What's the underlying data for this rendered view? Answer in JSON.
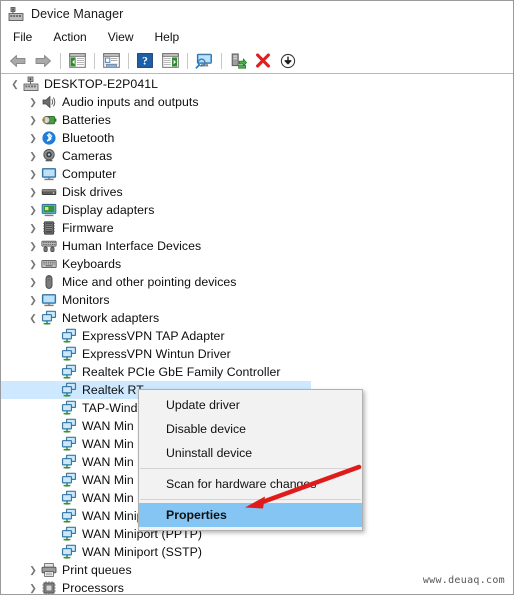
{
  "window": {
    "title": "Device Manager",
    "title_icon": "device-manager-icon"
  },
  "menubar": {
    "items": [
      {
        "label": "File",
        "name": "menu-file"
      },
      {
        "label": "Action",
        "name": "menu-action"
      },
      {
        "label": "View",
        "name": "menu-view"
      },
      {
        "label": "Help",
        "name": "menu-help"
      }
    ]
  },
  "toolbar": {
    "buttons": [
      {
        "icon": "back-arrow-icon",
        "name": "toolbar-back"
      },
      {
        "icon": "forward-arrow-icon",
        "name": "toolbar-forward"
      },
      {
        "sep": true
      },
      {
        "icon": "show-hide-console-tree-icon",
        "name": "toolbar-console-tree"
      },
      {
        "sep": true
      },
      {
        "icon": "properties-icon",
        "name": "toolbar-properties"
      },
      {
        "sep": true
      },
      {
        "icon": "help-icon",
        "name": "toolbar-help"
      },
      {
        "icon": "show-hide-action-pane-icon",
        "name": "toolbar-action-pane"
      },
      {
        "sep": true
      },
      {
        "icon": "scan-hardware-changes-icon",
        "name": "toolbar-scan-hardware"
      },
      {
        "sep": true
      },
      {
        "icon": "update-driver-icon",
        "name": "toolbar-update-driver"
      },
      {
        "icon": "uninstall-device-icon",
        "name": "toolbar-uninstall-device"
      },
      {
        "icon": "disable-device-icon",
        "name": "toolbar-disable-device"
      }
    ]
  },
  "tree": {
    "rows": [
      {
        "label": "DESKTOP-E2P041L",
        "level": 0,
        "state": "expanded",
        "icon": "computer-root-icon",
        "selected": false
      },
      {
        "label": "Audio inputs and outputs",
        "level": 1,
        "state": "collapsed",
        "icon": "speaker-icon",
        "selected": false
      },
      {
        "label": "Batteries",
        "level": 1,
        "state": "collapsed",
        "icon": "battery-icon",
        "selected": false
      },
      {
        "label": "Bluetooth",
        "level": 1,
        "state": "collapsed",
        "icon": "bluetooth-icon",
        "selected": false
      },
      {
        "label": "Cameras",
        "level": 1,
        "state": "collapsed",
        "icon": "camera-icon",
        "selected": false
      },
      {
        "label": "Computer",
        "level": 1,
        "state": "collapsed",
        "icon": "monitor-icon",
        "selected": false
      },
      {
        "label": "Disk drives",
        "level": 1,
        "state": "collapsed",
        "icon": "disk-drive-icon",
        "selected": false
      },
      {
        "label": "Display adapters",
        "level": 1,
        "state": "collapsed",
        "icon": "display-adapter-icon",
        "selected": false
      },
      {
        "label": "Firmware",
        "level": 1,
        "state": "collapsed",
        "icon": "firmware-icon",
        "selected": false
      },
      {
        "label": "Human Interface Devices",
        "level": 1,
        "state": "collapsed",
        "icon": "hid-icon",
        "selected": false
      },
      {
        "label": "Keyboards",
        "level": 1,
        "state": "collapsed",
        "icon": "keyboard-icon",
        "selected": false
      },
      {
        "label": "Mice and other pointing devices",
        "level": 1,
        "state": "collapsed",
        "icon": "mouse-icon",
        "selected": false
      },
      {
        "label": "Monitors",
        "level": 1,
        "state": "collapsed",
        "icon": "monitor-icon",
        "selected": false
      },
      {
        "label": "Network adapters",
        "level": 1,
        "state": "expanded",
        "icon": "network-adapter-icon",
        "selected": false
      },
      {
        "label": "ExpressVPN TAP Adapter",
        "level": 2,
        "state": "none",
        "icon": "network-adapter-icon",
        "selected": false
      },
      {
        "label": "ExpressVPN Wintun Driver",
        "level": 2,
        "state": "none",
        "icon": "network-adapter-icon",
        "selected": false
      },
      {
        "label": "Realtek PCIe GbE Family Controller",
        "level": 2,
        "state": "none",
        "icon": "network-adapter-icon",
        "selected": false
      },
      {
        "label": "Realtek RT",
        "level": 2,
        "state": "none",
        "icon": "network-adapter-icon",
        "selected": true
      },
      {
        "label": "TAP-Wind",
        "level": 2,
        "state": "none",
        "icon": "network-adapter-icon",
        "selected": false
      },
      {
        "label": "WAN Min",
        "level": 2,
        "state": "none",
        "icon": "network-adapter-icon",
        "selected": false
      },
      {
        "label": "WAN Min",
        "level": 2,
        "state": "none",
        "icon": "network-adapter-icon",
        "selected": false
      },
      {
        "label": "WAN Min",
        "level": 2,
        "state": "none",
        "icon": "network-adapter-icon",
        "selected": false
      },
      {
        "label": "WAN Min",
        "level": 2,
        "state": "none",
        "icon": "network-adapter-icon",
        "selected": false
      },
      {
        "label": "WAN Min",
        "level": 2,
        "state": "none",
        "icon": "network-adapter-icon",
        "selected": false
      },
      {
        "label": "WAN Miniport (PPPOE)",
        "level": 2,
        "state": "none",
        "icon": "network-adapter-icon",
        "selected": false
      },
      {
        "label": "WAN Miniport (PPTP)",
        "level": 2,
        "state": "none",
        "icon": "network-adapter-icon",
        "selected": false
      },
      {
        "label": "WAN Miniport (SSTP)",
        "level": 2,
        "state": "none",
        "icon": "network-adapter-icon",
        "selected": false
      },
      {
        "label": "Print queues",
        "level": 1,
        "state": "collapsed",
        "icon": "printer-icon",
        "selected": false
      },
      {
        "label": "Processors",
        "level": 1,
        "state": "collapsed",
        "icon": "processor-icon",
        "selected": false
      }
    ]
  },
  "context_menu": {
    "items": [
      {
        "label": "Update driver",
        "highlighted": false,
        "name": "ctx-update-driver"
      },
      {
        "label": "Disable device",
        "highlighted": false,
        "name": "ctx-disable-device"
      },
      {
        "label": "Uninstall device",
        "highlighted": false,
        "name": "ctx-uninstall-device"
      },
      {
        "separator": true
      },
      {
        "label": "Scan for hardware changes",
        "highlighted": false,
        "name": "ctx-scan-hardware-changes"
      },
      {
        "separator": true
      },
      {
        "label": "Properties",
        "highlighted": true,
        "name": "ctx-properties"
      }
    ]
  },
  "annotation": {
    "arrow_color": "#e01b1b",
    "points_to": "Properties"
  },
  "watermark": {
    "text": "www.deuaq.com"
  },
  "colors": {
    "selection": "#cde8ff",
    "menu_highlight": "#84c5f4",
    "arrow_red": "#e01b1b"
  }
}
